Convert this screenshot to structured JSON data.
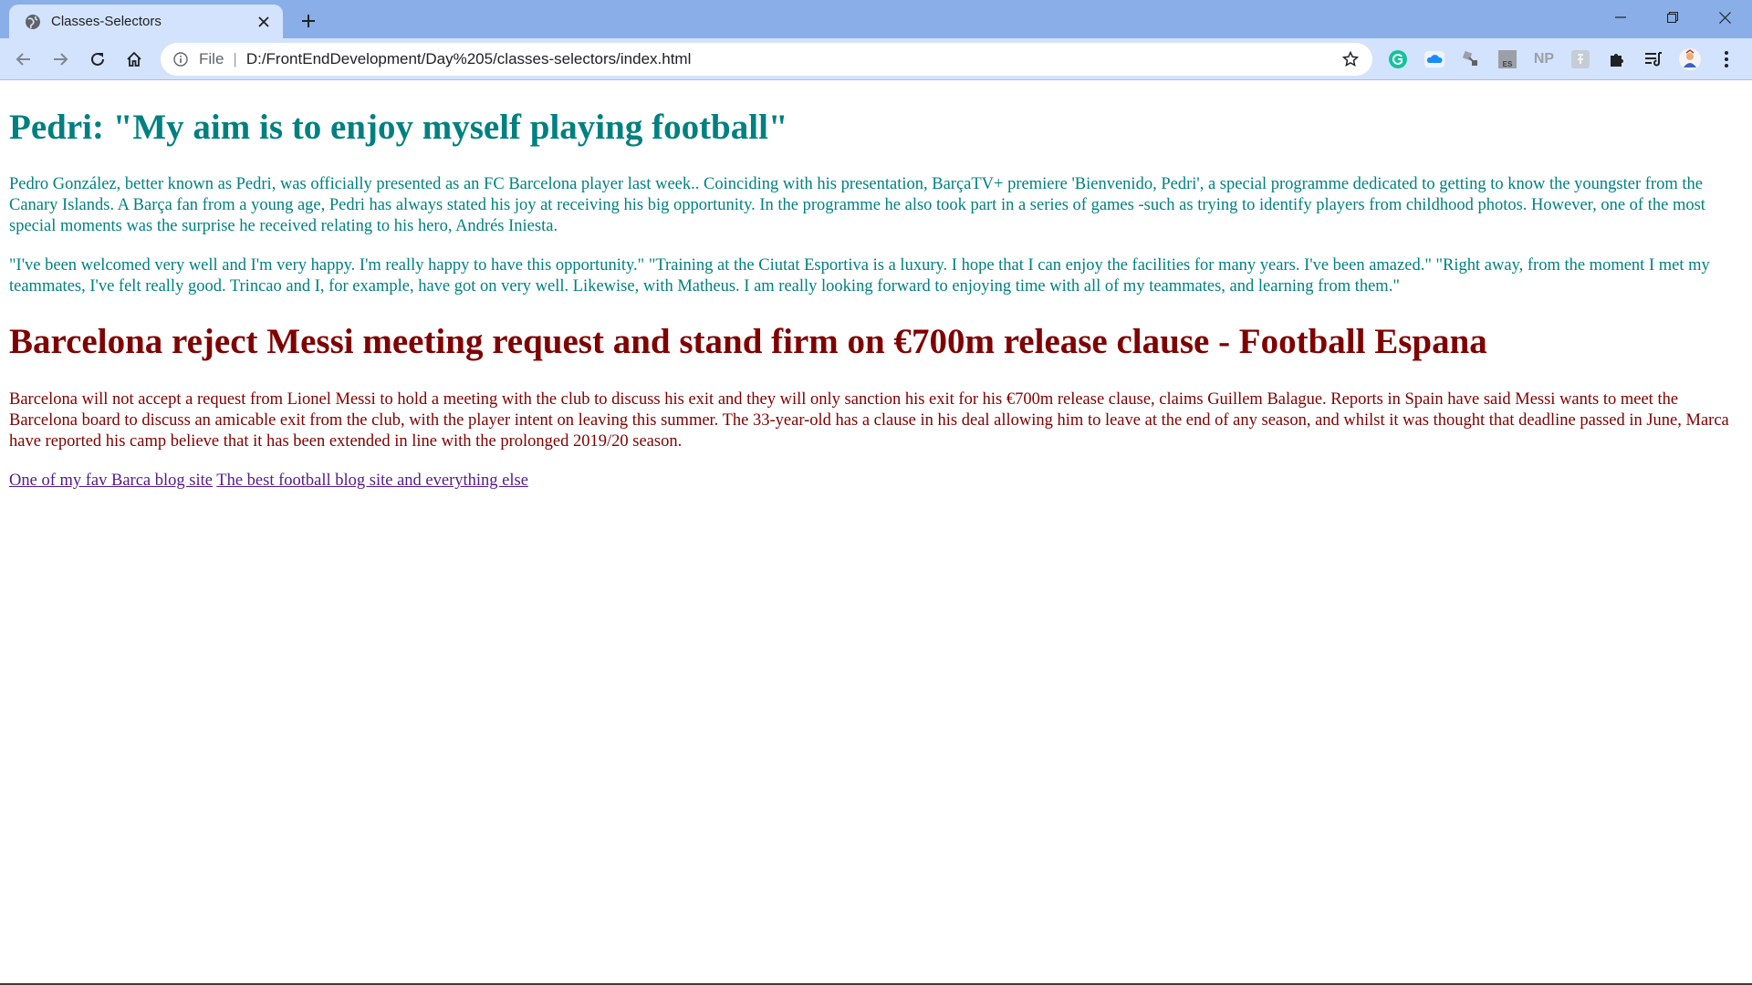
{
  "browser": {
    "tab_title": "Classes-Selectors",
    "address_scheme": "File",
    "address_separator": "|",
    "address_url": "D:/FrontEndDevelopment/Day%205/classes-selectors/index.html",
    "extensions": [
      "grammarly-icon",
      "cloud-icon",
      "satellite-icon",
      "es-icon",
      "np-icon",
      "fx-icon",
      "puzzle-icon",
      "reading-list-icon",
      "avatar",
      "more-icon"
    ],
    "ext_np_label": "NP",
    "ext_es_label": "ES"
  },
  "article1": {
    "heading": "Pedri: \"My aim is to enjoy myself playing football\"",
    "paragraph1": "Pedro González, better known as Pedri, was officially presented as an FC Barcelona player last week.. Coinciding with his presentation, BarçaTV+ premiere 'Bienvenido, Pedri', a special programme dedicated to getting to know the youngster from the Canary Islands. A Barça fan from a young age, Pedri has always stated his joy at receiving his big opportunity. In the programme he also took part in a series of games -such as trying to identify players from childhood photos. However, one of the most special moments was the surprise he received relating to his hero, Andrés Iniesta.",
    "paragraph2": "\"I've been welcomed very well and I'm very happy. I'm really happy to have this opportunity.\" \"Training at the Ciutat Esportiva is a luxury. I hope that I can enjoy the facilities for many years. I've been amazed.\" \"Right away, from the moment I met my teammates, I've felt really good. Trincao and I, for example, have got on very well. Likewise, with Matheus. I am really looking forward to enjoying time with all of my teammates, and learning from them.\""
  },
  "article2": {
    "heading": "Barcelona reject Messi meeting request and stand firm on €700m release clause - Football Espana",
    "paragraph": "Barcelona will not accept a request from Lionel Messi to hold a meeting with the club to discuss his exit and they will only sanction his exit for his €700m release clause, claims Guillem Balague. Reports in Spain have said Messi wants to meet the Barcelona board to discuss an amicable exit from the club, with the player intent on leaving this summer. The 33-year-old has a clause in his deal allowing him to leave at the end of any season, and whilst it was thought that deadline passed in June, Marca have reported his camp believe that it has been extended in line with the prolonged 2019/20 season."
  },
  "links": {
    "link1": "One of my fav Barca blog site",
    "link2": "The best football blog site and everything else"
  },
  "colors": {
    "teal": "#008080",
    "maroon": "#800000",
    "visited_link": "#551a8b",
    "chrome_tabbar": "#8aaee8",
    "chrome_toolbar": "#d3e3fd"
  }
}
